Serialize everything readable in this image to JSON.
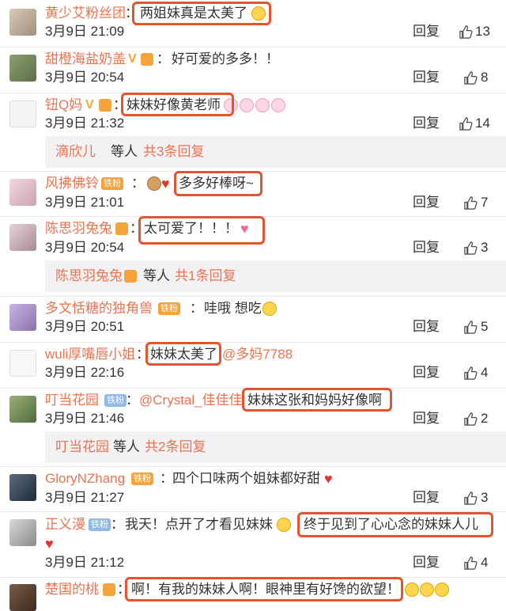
{
  "comments": [
    {
      "name": "黄少艾粉丝团",
      "sep": "：",
      "text": "两姐妹真是太美了",
      "date": "3月9日 21:09",
      "reply": "回复",
      "likes": "13"
    },
    {
      "name": "甜橙海盐奶盖",
      "sep": "：",
      "text": "好可爱的多多！！",
      "date": "3月9日 20:54",
      "reply": "回复",
      "likes": "8"
    },
    {
      "name": "钮Q妈",
      "sep": "：",
      "text": "妹妹好像黄老师",
      "date": "3月9日 21:32",
      "reply": "回复",
      "likes": "14"
    },
    {
      "name": "风拂佛铃",
      "sep": "：",
      "text": "多多好棒呀~",
      "date": "3月9日 21:01",
      "reply": "回复",
      "likes": "7"
    },
    {
      "name": "陈思羽兔兔",
      "sep": "：",
      "text": "太可爱了！！！",
      "date": "3月9日 20:54",
      "reply": "回复",
      "likes": "3"
    },
    {
      "name": "多文恬糖的独角兽",
      "sep": "：",
      "text": "哇哦 想吃",
      "date": "3月9日 20:51",
      "reply": "回复",
      "likes": "5"
    },
    {
      "name": "wuli厚嘴唇小姐",
      "sep": "：",
      "text": "妹妹太美了",
      "mention": "@多妈7788",
      "date": "3月9日 22:16",
      "reply": "回复",
      "likes": "4"
    },
    {
      "name": "叮当花园",
      "sep": "：",
      "mention": "@Crystal_佳佳佳",
      "text": "妹妹这张和妈妈好像啊",
      "date": "3月9日 21:46",
      "reply": "回复",
      "likes": "2"
    },
    {
      "name": "GloryNZhang",
      "sep": "：",
      "text": "四个口味两个姐妹都好甜",
      "date": "3月9日 21:27",
      "reply": "回复",
      "likes": "3"
    },
    {
      "name": "正义漫",
      "sep": "：",
      "text_pre": "我天！点开了才看见妹妹",
      "text": "终于见到了心心念的妹妹人儿",
      "date": "3月9日 21:12",
      "reply": "回复",
      "likes": "4"
    },
    {
      "name": "楚国的桃",
      "sep": "：",
      "text": "啊！有我的妹妹人啊！眼神里有好馋的欲望！"
    }
  ],
  "sub_replies": [
    {
      "name": "滴欣儿",
      "label": "等人",
      "count": "共3条回复"
    },
    {
      "name": "陈思羽兔兔",
      "label": "等人",
      "count": "共1条回复"
    },
    {
      "name": "叮当花园",
      "label": "等人",
      "count": "共2条回复"
    }
  ],
  "badges": {
    "tiefen": "铁粉"
  },
  "icons": {
    "like": "thumbs-up-icon",
    "heart": "heart-icon",
    "face": "emoji-face-icon"
  },
  "colors": {
    "username": "#eb7350",
    "highlight_box": "#e5532f",
    "subbar_bg": "#f2f2f5"
  }
}
